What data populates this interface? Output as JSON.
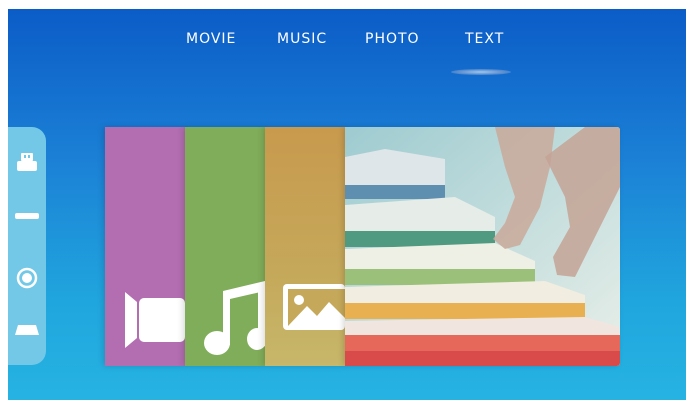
{
  "tabs": [
    {
      "label": "MOVIE",
      "active": false
    },
    {
      "label": "MUSIC",
      "active": false
    },
    {
      "label": "PHOTO",
      "active": false
    },
    {
      "label": "TEXT",
      "active": true
    }
  ],
  "sidebar": {
    "items": [
      {
        "icon": "usb-drive-icon"
      },
      {
        "icon": "hard-drive-icon"
      },
      {
        "icon": "disc-icon"
      },
      {
        "icon": "card-reader-icon"
      }
    ]
  },
  "cards": [
    {
      "id": "movie",
      "icon": "video-camera-icon",
      "color": "#b26eb0"
    },
    {
      "id": "music",
      "icon": "music-note-icon",
      "color": "#80ad5a"
    },
    {
      "id": "photo",
      "icon": "image-icon",
      "color": "#c5a85a"
    },
    {
      "id": "text",
      "icon": "books-stack-image",
      "color": "#c3dfdd"
    }
  ],
  "colors": {
    "background_top": "#0b5cc7",
    "background_bottom": "#26b3e2",
    "sidebar": "#72c8e6"
  }
}
